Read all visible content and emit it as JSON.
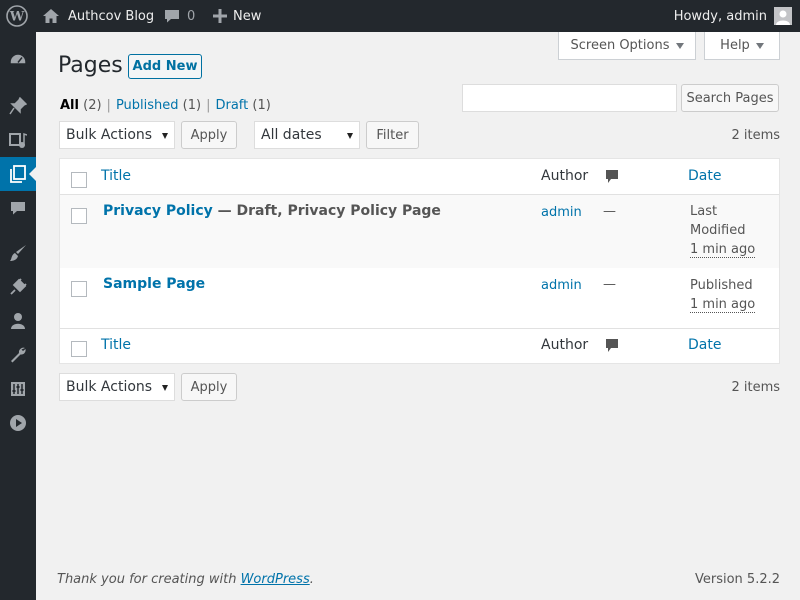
{
  "adminbar": {
    "site_name": "Authcov Blog",
    "comments_count": "0",
    "new_label": "New",
    "greeting": "Howdy, admin",
    "icons": [
      "wordpress-logo-icon",
      "home-icon",
      "comment-icon",
      "plus-icon",
      "user-avatar"
    ]
  },
  "sidebar": {
    "items": [
      {
        "name": "dashboard",
        "icon": "dashboard-icon"
      },
      {
        "name": "posts",
        "icon": "pin-icon"
      },
      {
        "name": "media",
        "icon": "media-icon"
      },
      {
        "name": "pages",
        "icon": "pages-icon",
        "current": true
      },
      {
        "name": "comments",
        "icon": "comment-icon"
      },
      {
        "name": "appearance",
        "icon": "brush-icon"
      },
      {
        "name": "plugins",
        "icon": "plugin-icon"
      },
      {
        "name": "users",
        "icon": "user-icon"
      },
      {
        "name": "tools",
        "icon": "wrench-icon"
      },
      {
        "name": "settings",
        "icon": "settings-icon"
      },
      {
        "name": "collapse",
        "icon": "play-icon"
      }
    ]
  },
  "screen_meta": {
    "screen_options": "Screen Options",
    "help": "Help"
  },
  "header": {
    "title": "Pages",
    "add_new": "Add New"
  },
  "views": {
    "all": {
      "label": "All",
      "count": "(2)"
    },
    "published": {
      "label": "Published",
      "count": "(1)"
    },
    "draft": {
      "label": "Draft",
      "count": "(1)"
    },
    "separator": "|"
  },
  "search": {
    "placeholder": "",
    "button": "Search Pages"
  },
  "tablenav_top": {
    "bulk_actions": "Bulk Actions",
    "apply": "Apply",
    "dates": "All dates",
    "filter": "Filter",
    "items": "2 items"
  },
  "table": {
    "columns": {
      "title": "Title",
      "author": "Author",
      "date": "Date"
    },
    "rows": [
      {
        "title": "Privacy Policy",
        "state": " — Draft, Privacy Policy Page",
        "author": "admin",
        "comments": "—",
        "date_status_1": "Last",
        "date_status_2": "Modified",
        "date_value": "1 min ago"
      },
      {
        "title": "Sample Page",
        "state": "",
        "author": "admin",
        "comments": "—",
        "date_status_1": "Published",
        "date_value": "1 min ago"
      }
    ]
  },
  "tablenav_bottom": {
    "bulk_actions": "Bulk Actions",
    "apply": "Apply",
    "items": "2 items"
  },
  "footer": {
    "thanks_prefix": "Thank you for creating with ",
    "thanks_link": "WordPress",
    "thanks_suffix": ".",
    "version": "Version 5.2.2"
  },
  "colors": {
    "adminbar_bg": "#23282d",
    "accent": "#0073aa",
    "page_bg": "#f1f1f1"
  }
}
